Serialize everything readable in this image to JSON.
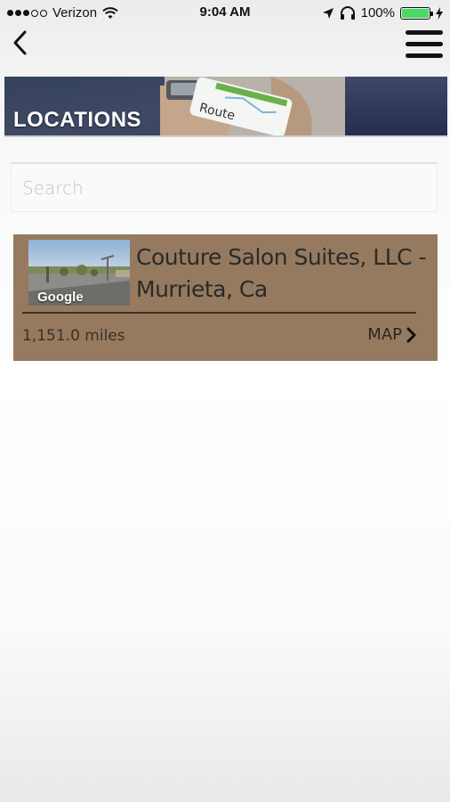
{
  "status_bar": {
    "carrier": "Verizon",
    "time": "9:04 AM",
    "battery_percent": "100%",
    "battery_level": 1.0,
    "signal_bars_filled": 3,
    "signal_bars_total": 5
  },
  "nav": {
    "back_icon": "chevron-left-icon",
    "menu_icon": "hamburger-menu-icon"
  },
  "banner": {
    "title": "LOCATIONS",
    "image_text": "Route"
  },
  "search": {
    "placeholder": "Search",
    "value": ""
  },
  "locations": [
    {
      "name": "Couture Salon Suites, LLC - Murrieta, Ca",
      "distance": "1,151.0 miles",
      "map_label": "MAP",
      "thumbnail_watermark": "Google"
    }
  ],
  "colors": {
    "card_background": "#957a5f",
    "battery_green": "#4cd964",
    "banner_title": "#ffffff"
  }
}
